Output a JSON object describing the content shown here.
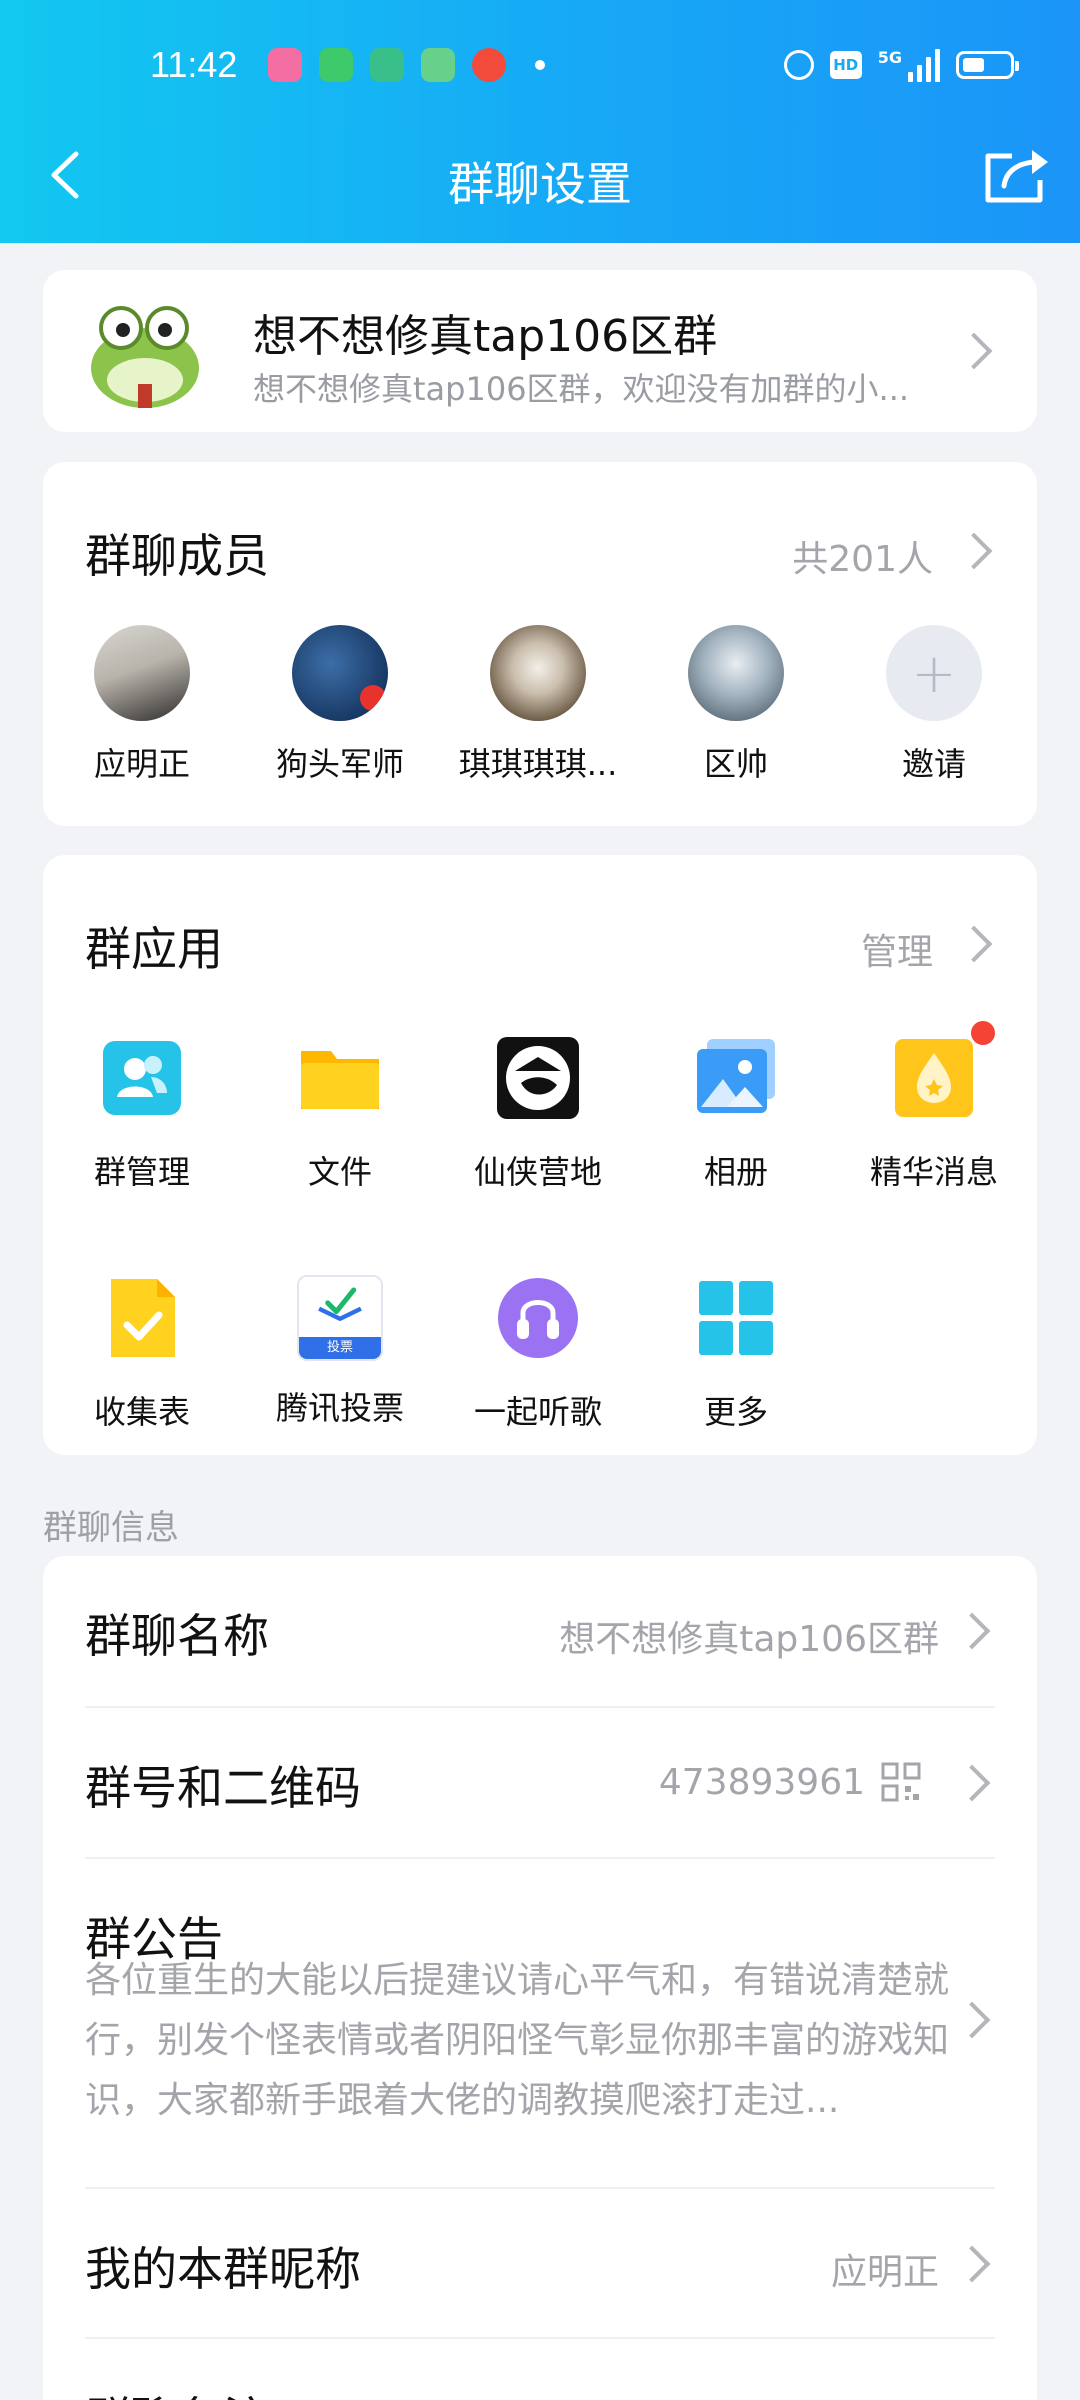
{
  "status_bar": {
    "time": "11:42",
    "signal": "5G",
    "hd": "HD",
    "battery_level": 0.45
  },
  "nav": {
    "title": "群聊设置"
  },
  "group": {
    "name": "想不想修真tap106区群",
    "description": "想不想修真tap106区群，欢迎没有加群的小..."
  },
  "members": {
    "title": "群聊成员",
    "count": "共201人",
    "list": [
      {
        "name": "应明正"
      },
      {
        "name": "狗头军师"
      },
      {
        "name": "琪琪琪琪..."
      },
      {
        "name": "区帅"
      }
    ],
    "invite_label": "邀请",
    "invite_icon": "+"
  },
  "apps": {
    "title": "群应用",
    "manage_label": "管理",
    "items": [
      {
        "label": "群管理",
        "icon": "group-manage-icon"
      },
      {
        "label": "文件",
        "icon": "folder-icon"
      },
      {
        "label": "仙侠营地",
        "icon": "xianxia-camp-icon"
      },
      {
        "label": "相册",
        "icon": "album-icon"
      },
      {
        "label": "精华消息",
        "icon": "essence-message-icon"
      },
      {
        "label": "收集表",
        "icon": "collect-form-icon"
      },
      {
        "label": "腾讯投票",
        "icon": "vote-icon",
        "badge": "投票"
      },
      {
        "label": "一起听歌",
        "icon": "listen-music-icon"
      },
      {
        "label": "更多",
        "icon": "more-grid-icon"
      }
    ]
  },
  "info": {
    "section_label": "群聊信息",
    "group_name_label": "群聊名称",
    "group_name_value": "想不想修真tap106区群",
    "group_id_label": "群号和二维码",
    "group_id_value": "473893961",
    "notice_label": "群公告",
    "notice_text": "各位重生的大能以后提建议请心平气和，有错说清楚就行，别发个怪表情或者阴阳怪气彰显你那丰富的游戏知识，大家都新手跟着大佬的调教摸爬滚打走过...",
    "nickname_label": "我的本群昵称",
    "nickname_value": "应明正",
    "remark_label": "群聊备注"
  },
  "colors": {
    "header_start": "#12c8f0",
    "header_end": "#1b95f8",
    "secondary_text": "#a3a5ab",
    "red_badge": "#f54336"
  }
}
